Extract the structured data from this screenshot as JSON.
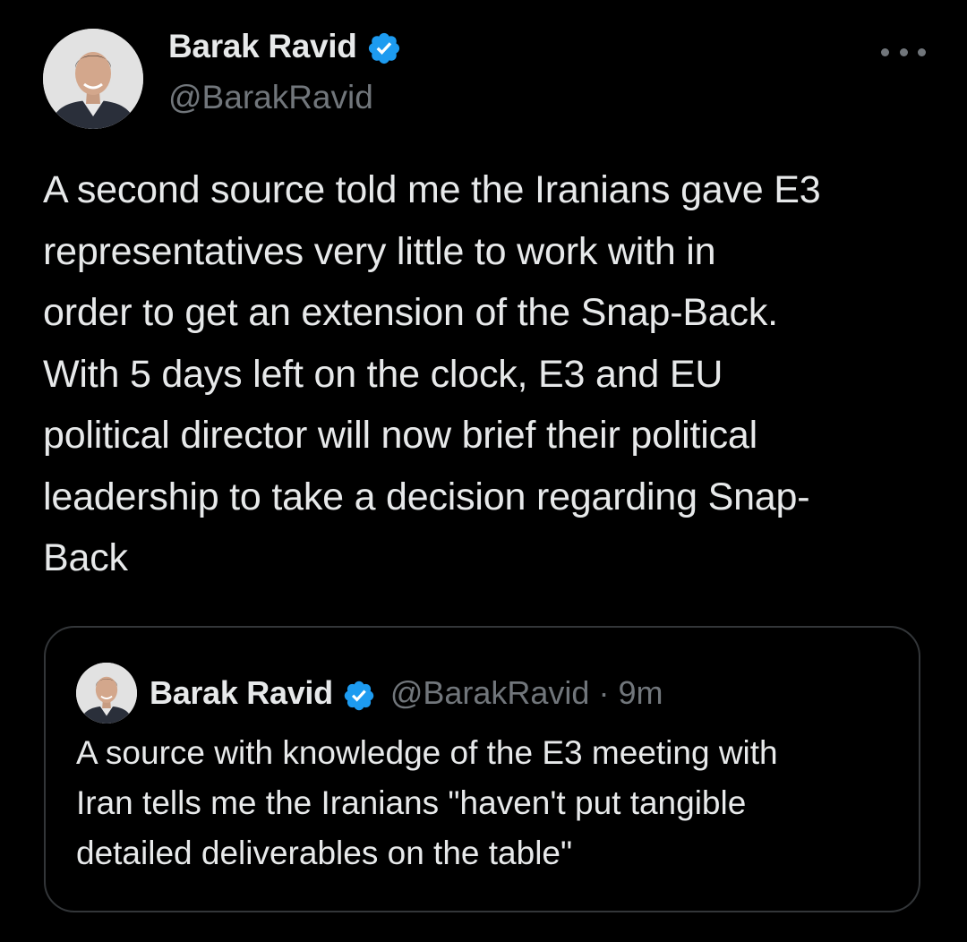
{
  "tweet": {
    "author": {
      "display_name": "Barak Ravid",
      "handle": "@BarakRavid",
      "verified_icon": "verified-badge-icon",
      "avatar": "profile-photo"
    },
    "more_icon": "more-horizontal-icon",
    "text": "A second source told me the Iranians gave E3\nrepresentatives very little to work with in\norder to get an extension of the Snap-Back.\nWith 5 days left on the clock, E3 and EU\npolitical director will now brief their political\nleadership to take a decision regarding Snap-\nBack",
    "quoted_tweet": {
      "display_name": "Barak Ravid",
      "handle": "@BarakRavid",
      "separator": "·",
      "time": "9m",
      "text": "A source with knowledge of the E3 meeting with\nIran tells me the Iranians \"haven't put tangible\ndetailed deliverables on the table\""
    }
  },
  "colors": {
    "background": "#000000",
    "primary_text": "#e7e9ea",
    "secondary_text": "#71767b",
    "verified_blue": "#1d9bf0",
    "border": "#333639"
  }
}
